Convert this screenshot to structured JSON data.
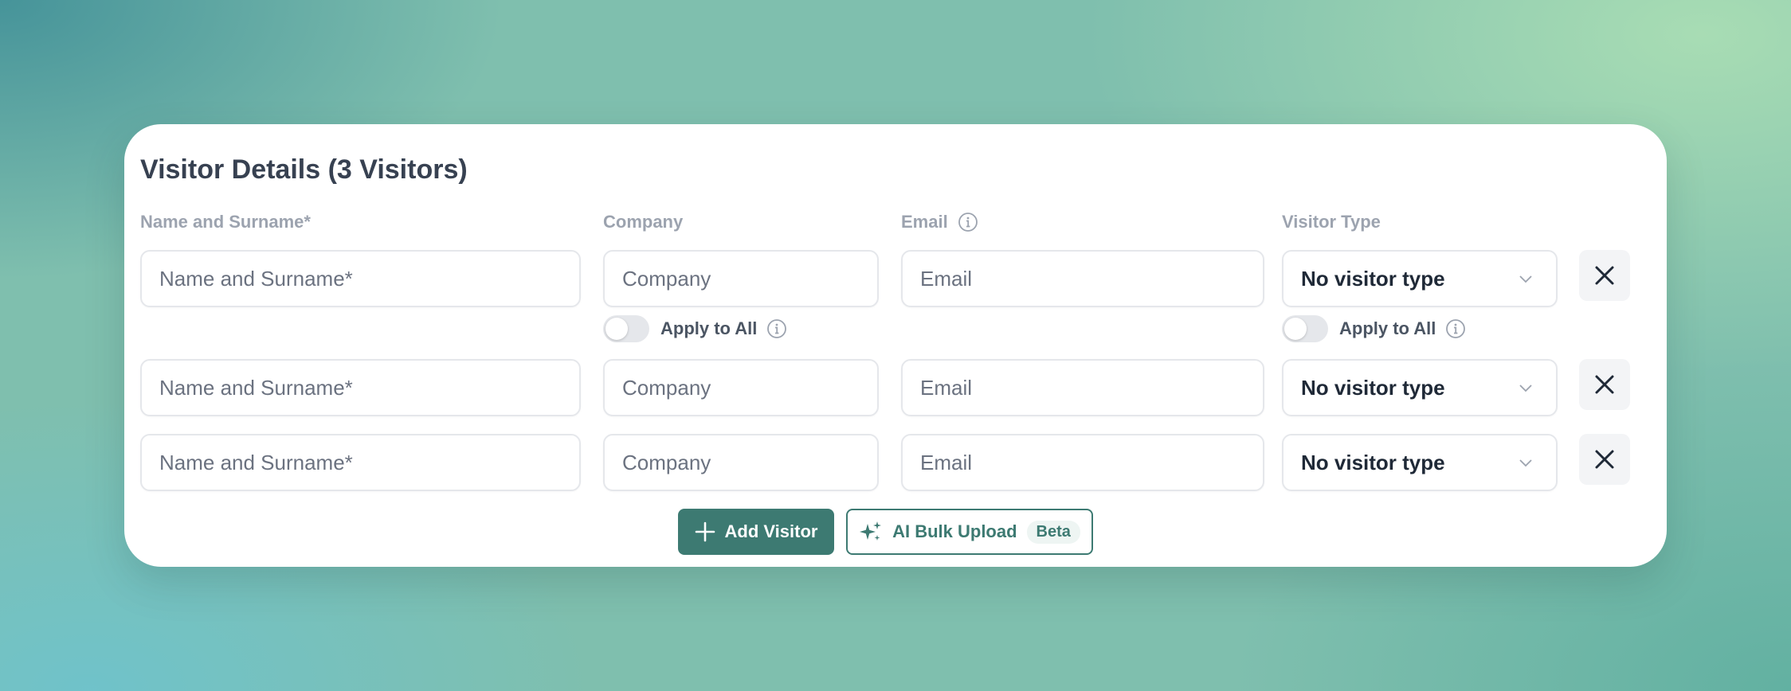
{
  "form": {
    "title": "Visitor Details (3 Visitors)",
    "labels": {
      "name": "Name and Surname*",
      "company": "Company",
      "email": "Email",
      "visitor_type": "Visitor Type"
    },
    "placeholders": {
      "name": "Name and Surname*",
      "company": "Company",
      "email": "Email"
    },
    "rows": [
      {
        "name": "",
        "company": "",
        "email": "",
        "visitor_type": "No visitor type"
      },
      {
        "name": "",
        "company": "",
        "email": "",
        "visitor_type": "No visitor type"
      },
      {
        "name": "",
        "company": "",
        "email": "",
        "visitor_type": "No visitor type"
      }
    ],
    "apply_to_all_label": "Apply to All",
    "add_visitor_label": "Add Visitor",
    "ai_bulk_upload_label": "AI Bulk Upload",
    "beta_badge": "Beta"
  },
  "colors": {
    "accent": "#3d7a72",
    "label": "#9ca3af",
    "title": "#374151"
  },
  "icons": {
    "info": "info-icon",
    "chevron": "chevron-down-icon",
    "close": "close-icon",
    "plus": "plus-icon",
    "sparkles": "sparkles-icon"
  }
}
